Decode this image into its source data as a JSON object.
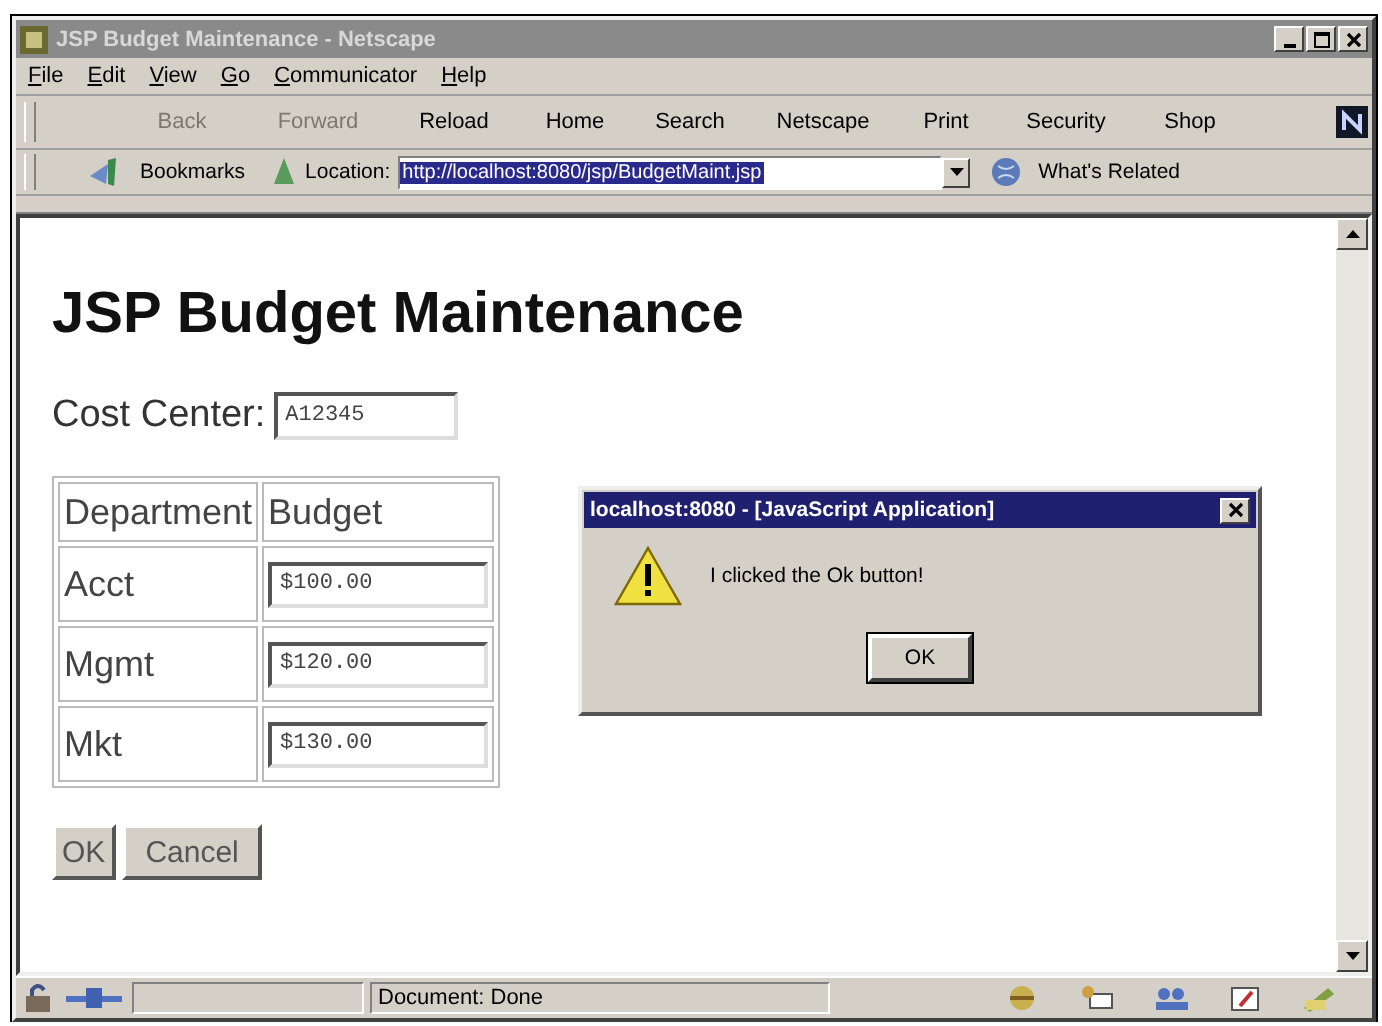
{
  "window": {
    "title": "JSP Budget Maintenance - Netscape"
  },
  "menu": [
    "File",
    "Edit",
    "View",
    "Go",
    "Communicator",
    "Help"
  ],
  "toolbar": [
    {
      "label": "Back",
      "disabled": true
    },
    {
      "label": "Forward",
      "disabled": true
    },
    {
      "label": "Reload",
      "disabled": false
    },
    {
      "label": "Home",
      "disabled": false
    },
    {
      "label": "Search",
      "disabled": false
    },
    {
      "label": "Netscape",
      "disabled": false
    },
    {
      "label": "Print",
      "disabled": false
    },
    {
      "label": "Security",
      "disabled": false
    },
    {
      "label": "Shop",
      "disabled": false
    }
  ],
  "location_bar": {
    "bookmarks_label": "Bookmarks",
    "location_label": "Location:",
    "url": "http://localhost:8080/jsp/BudgetMaint.jsp",
    "url_selected": true,
    "related_label": "What's Related"
  },
  "page": {
    "heading": "JSP Budget Maintenance",
    "cost_center": {
      "label": "Cost Center:",
      "value": "A12345"
    },
    "table": {
      "columns": [
        "Department",
        "Budget"
      ],
      "rows": [
        {
          "department": "Acct",
          "budget": "$100.00"
        },
        {
          "department": "Mgmt",
          "budget": "$120.00"
        },
        {
          "department": "Mkt",
          "budget": "$130.00"
        }
      ]
    },
    "buttons": [
      "OK",
      "Cancel"
    ]
  },
  "dialog": {
    "title": "localhost:8080 - [JavaScript Application]",
    "message": "I clicked the Ok button!",
    "button": "OK"
  },
  "status_bar": {
    "text": "Document: Done"
  }
}
